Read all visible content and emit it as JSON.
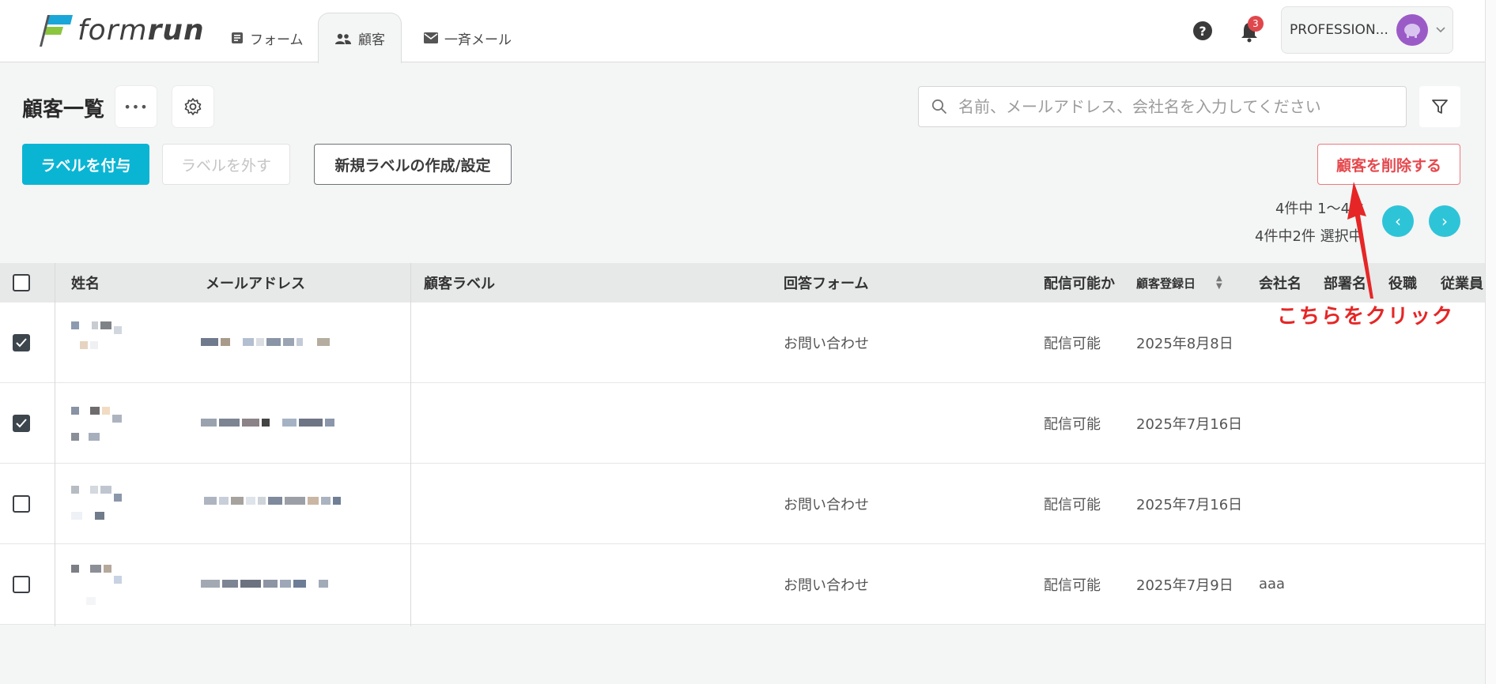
{
  "app": {
    "logo_text_light": "form",
    "logo_text_bold": "run"
  },
  "nav": {
    "tabs": [
      {
        "label": "フォーム",
        "icon": "form-icon"
      },
      {
        "label": "顧客",
        "icon": "people-icon",
        "active": true
      },
      {
        "label": "一斉メール",
        "icon": "mail-icon"
      }
    ]
  },
  "header": {
    "help_icon": "?",
    "notification_count": "3",
    "account_name": "PROFESSION...",
    "dropdown_icon": "chevron-down-icon"
  },
  "page": {
    "title": "顧客一覧",
    "more_label": "•••",
    "search_placeholder": "名前、メールアドレス、会社名を入力してください"
  },
  "actions": {
    "add_label": "ラベルを付与",
    "remove_label": "ラベルを外す",
    "create_label": "新規ラベルの作成/設定",
    "delete_customers": "顧客を削除する"
  },
  "pagination": {
    "range_text": "4件中 1〜4件",
    "selected_text": "4件中2件 選択中",
    "prev": "‹",
    "next": "›"
  },
  "table": {
    "columns": [
      "姓名",
      "メールアドレス",
      "顧客ラベル",
      "回答フォーム",
      "配信可能か",
      "顧客登録日",
      "会社名",
      "部署名",
      "役職",
      "従業員"
    ],
    "rows": [
      {
        "checked": true,
        "label": "",
        "form": "お問い合わせ",
        "deliverable": "配信可能",
        "registered": "2025年8月8日",
        "company": ""
      },
      {
        "checked": true,
        "label": "",
        "form": "",
        "deliverable": "配信可能",
        "registered": "2025年7月16日",
        "company": ""
      },
      {
        "checked": false,
        "label": "",
        "form": "お問い合わせ",
        "deliverable": "配信可能",
        "registered": "2025年7月16日",
        "company": ""
      },
      {
        "checked": false,
        "label": "",
        "form": "お問い合わせ",
        "deliverable": "配信可能",
        "registered": "2025年7月9日",
        "company": "aaa"
      }
    ]
  },
  "annotation": {
    "text": "こちらをクリック",
    "color": "#e62626"
  },
  "colors": {
    "primary": "#0ab5d4",
    "danger": "#e5484d",
    "pager": "#2ec4d8"
  }
}
